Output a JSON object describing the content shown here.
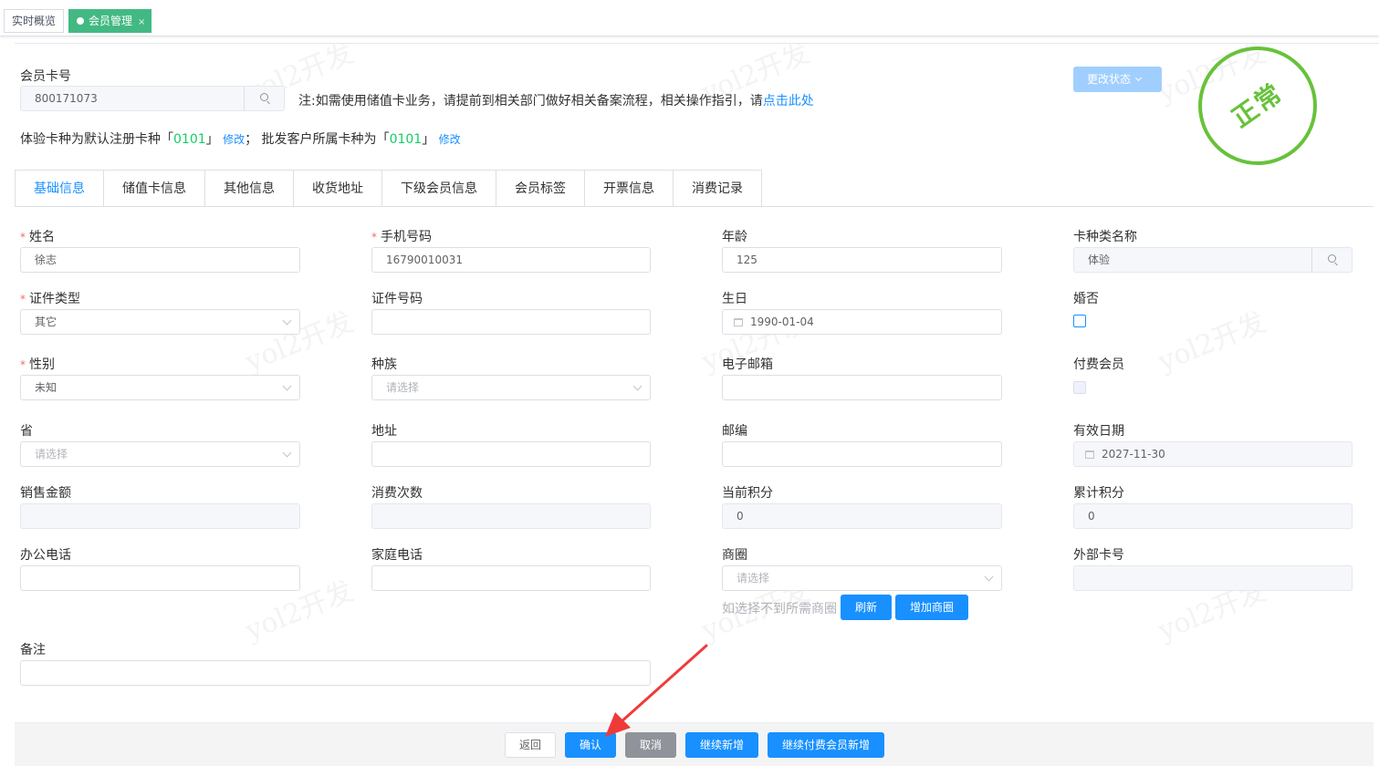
{
  "top_tabs": [
    {
      "label": "实时概览"
    },
    {
      "label": "会员管理",
      "close": "×"
    }
  ],
  "card": {
    "label": "会员卡号",
    "value": "800171073",
    "note_prefix": "注:如需使用储值卡业务，请提前到相关部门做好相关备案流程，相关操作指引，请",
    "note_link": "点击此处"
  },
  "line2": {
    "t1": "体验卡种为默认注册卡种「",
    "code1": "0101",
    "t2": "」",
    "edit1": "修改",
    "t3": "；  批发客户所属卡种为「",
    "code2": "0101",
    "t4": "」",
    "edit2": "修改"
  },
  "status_button": "更改状态",
  "stamp": "正常",
  "form_tabs": [
    "基础信息",
    "储值卡信息",
    "其他信息",
    "收货地址",
    "下级会员信息",
    "会员标签",
    "开票信息",
    "消费记录"
  ],
  "fields": {
    "name": {
      "label": "姓名",
      "value": "徐志"
    },
    "phone": {
      "label": "手机号码",
      "value": "16790010031"
    },
    "age": {
      "label": "年龄",
      "value": "125"
    },
    "card_type": {
      "label": "卡种类名称",
      "value": "体验"
    },
    "id_type": {
      "label": "证件类型",
      "value": "其它"
    },
    "id_no": {
      "label": "证件号码",
      "value": ""
    },
    "birthday": {
      "label": "生日",
      "value": "1990-01-04"
    },
    "married": {
      "label": "婚否"
    },
    "gender": {
      "label": "性别",
      "value": "未知"
    },
    "ethnic": {
      "label": "种族",
      "placeholder": "请选择"
    },
    "email": {
      "label": "电子邮箱",
      "value": ""
    },
    "paid": {
      "label": "付费会员"
    },
    "province": {
      "label": "省",
      "placeholder": "请选择"
    },
    "address": {
      "label": "地址",
      "value": ""
    },
    "zip": {
      "label": "邮编",
      "value": ""
    },
    "valid_date": {
      "label": "有效日期",
      "value": "2027-11-30"
    },
    "sales": {
      "label": "销售金额",
      "value": ""
    },
    "visits": {
      "label": "消费次数",
      "value": ""
    },
    "points": {
      "label": "当前积分",
      "value": "0"
    },
    "total_points": {
      "label": "累计积分",
      "value": "0"
    },
    "office_tel": {
      "label": "办公电话",
      "value": ""
    },
    "home_tel": {
      "label": "家庭电话",
      "value": ""
    },
    "district": {
      "label": "商圈",
      "placeholder": "请选择"
    },
    "ext_card": {
      "label": "外部卡号",
      "value": ""
    },
    "remark": {
      "label": "备注",
      "value": ""
    }
  },
  "district_hint": "如选择不到所需商圈",
  "district_buttons": {
    "refresh": "刷新",
    "add": "增加商圈"
  },
  "footer": {
    "back": "返回",
    "confirm": "确认",
    "cancel": "取消",
    "continue_add": "继续新增",
    "continue_paid_add": "继续付费会员新增"
  },
  "watermark": "yol2开发",
  "colors": {
    "primary": "#1890ff",
    "accent_green": "#42b983",
    "stamp_green": "#67c23a",
    "code_green": "#13ce66",
    "required": "#f56c6c"
  }
}
